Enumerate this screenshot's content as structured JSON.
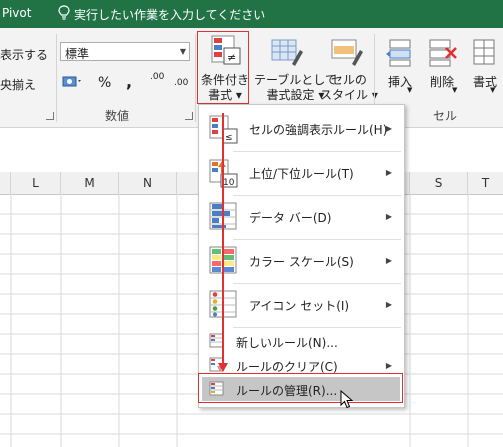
{
  "titlebar": {
    "app_fragment": "Pivot",
    "tell_me": "実行したい作業を入力してください"
  },
  "ribbon": {
    "alignment": {
      "wrap_text": "表示する",
      "merge_center": "央揃え"
    },
    "number": {
      "format_value": "標準",
      "group_label": "数値",
      "percent": "%",
      "comma": ",",
      "inc_decimal": ".00",
      "dec_decimal": ".00"
    },
    "styles": {
      "conditional_formatting": [
        "条件付き",
        "書式 ▾"
      ],
      "format_as_table": [
        "テーブルとして",
        "書式設定 ▾"
      ],
      "cell_styles": [
        "セルの",
        "スタイル ▾"
      ]
    },
    "cells": {
      "insert": "挿入",
      "delete": "削除",
      "format": "書式",
      "group_label": "セル"
    }
  },
  "columns": [
    "L",
    "M",
    "N",
    "",
    "S",
    "T"
  ],
  "menu": {
    "items": [
      {
        "label": "セルの強調表示ルール(H)",
        "submenu": true,
        "icon": "highlight-rules-icon"
      },
      {
        "label": "上位/下位ルール(T)",
        "submenu": true,
        "icon": "top-bottom-icon",
        "icon_text": "10"
      },
      {
        "label": "データ バー(D)",
        "submenu": true,
        "icon": "data-bars-icon"
      },
      {
        "label": "カラー スケール(S)",
        "submenu": true,
        "icon": "color-scales-icon"
      },
      {
        "label": "アイコン セット(I)",
        "submenu": true,
        "icon": "icon-sets-icon"
      },
      {
        "label": "新しいルール(N)...",
        "submenu": false,
        "icon": "new-rule-icon"
      },
      {
        "label": "ルールのクリア(C)",
        "submenu": true,
        "icon": "clear-rules-icon"
      },
      {
        "label": "ルールの管理(R)...",
        "submenu": false,
        "icon": "manage-rules-icon"
      }
    ],
    "selected_index": 7
  },
  "colors": {
    "excel_green": "#217346",
    "annotation_red": "#e03030",
    "menu_highlight": "#c6c6c6"
  }
}
